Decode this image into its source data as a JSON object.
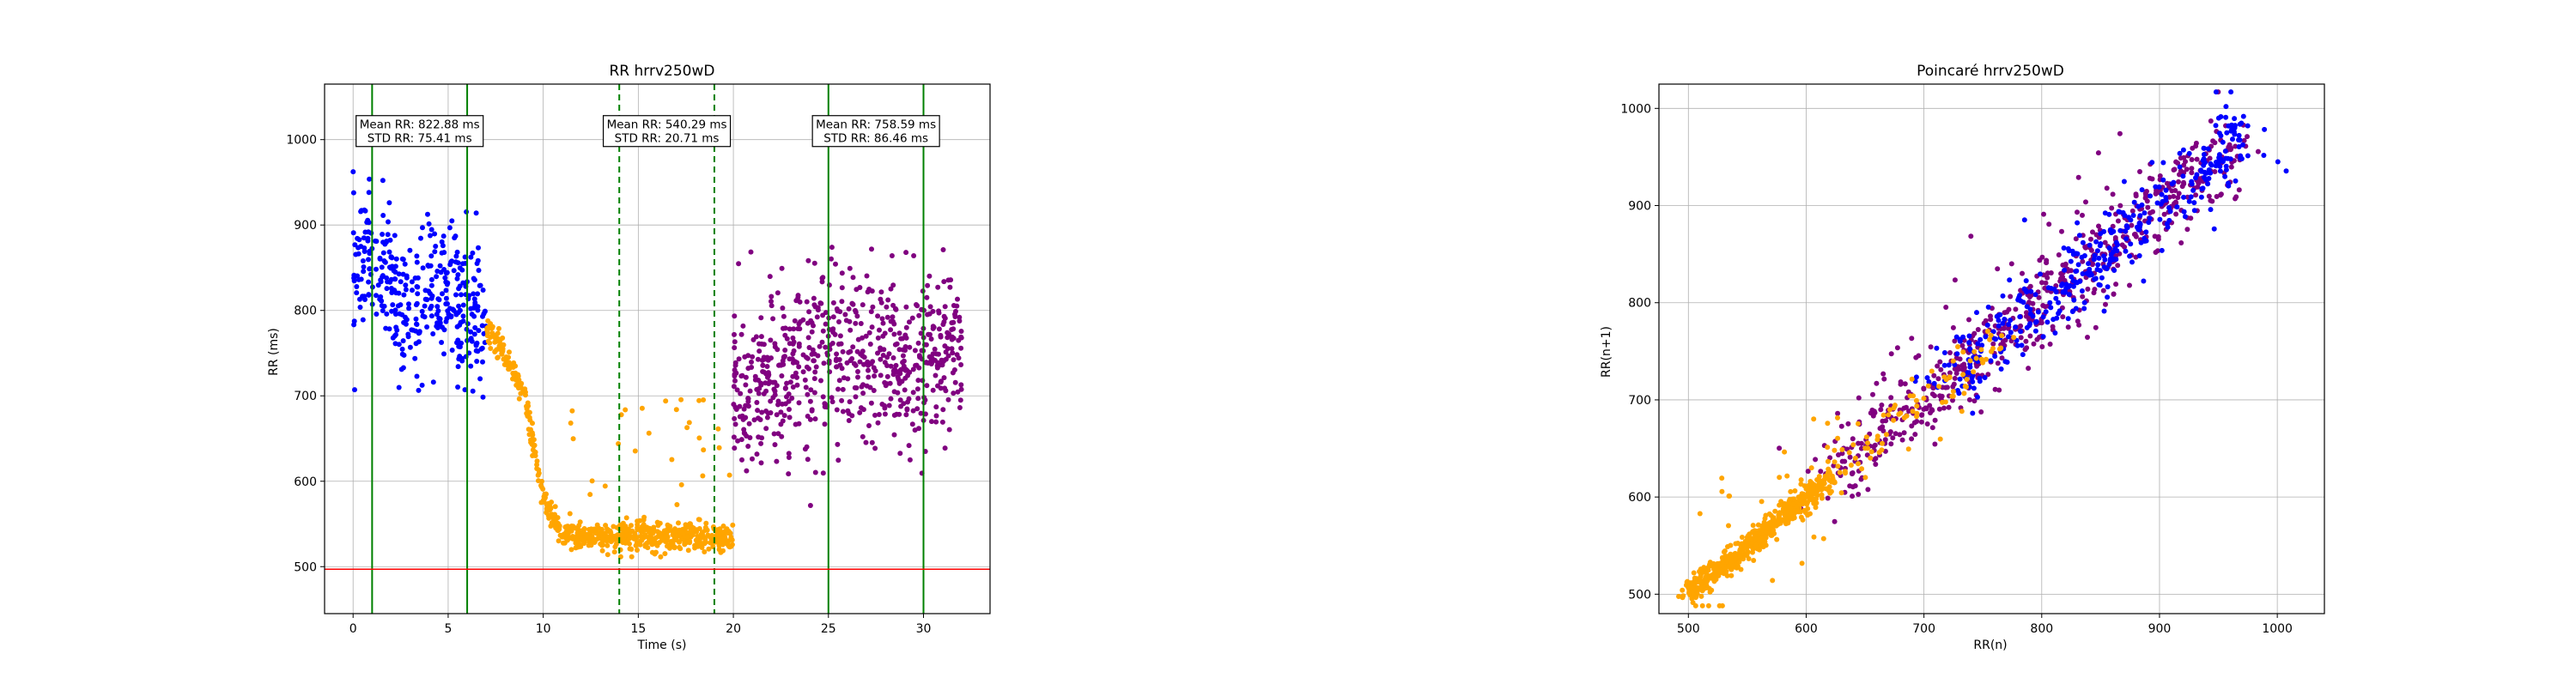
{
  "chart_data": [
    {
      "type": "scatter",
      "title": "RR hrrv250wD",
      "xlabel": "Time (s)",
      "ylabel": "RR (ms)",
      "xlim": [
        -1.5,
        33.5
      ],
      "ylim": [
        445,
        1065
      ],
      "xticks": [
        0,
        5,
        10,
        15,
        20,
        25,
        30
      ],
      "yticks": [
        500,
        600,
        700,
        800,
        900,
        1000
      ],
      "grid": true,
      "colors": {
        "series_a": "#0000ff",
        "series_b": "#ffa500",
        "series_c": "#800080",
        "window": "#008000",
        "threshold": "#ff0000"
      },
      "segments": [
        {
          "color": "series_a",
          "x_range": [
            0,
            7
          ],
          "level_points": [
            [
              0,
              850
            ],
            [
              1,
              860
            ],
            [
              2,
              830
            ],
            [
              3,
              780
            ],
            [
              4,
              840
            ],
            [
              5,
              820
            ],
            [
              6,
              800
            ],
            [
              7,
              790
            ]
          ],
          "spread": 75,
          "count": 380
        },
        {
          "color": "series_b",
          "x_range": [
            7,
            20
          ],
          "level_points": [
            [
              7,
              780
            ],
            [
              8,
              750
            ],
            [
              9,
              700
            ],
            [
              10,
              580
            ],
            [
              11,
              535
            ],
            [
              20,
              535
            ]
          ],
          "spread": 15,
          "count": 700
        },
        {
          "color": "series_c",
          "x_range": [
            20,
            32
          ],
          "level_points": [
            [
              20,
              700
            ],
            [
              22,
              720
            ],
            [
              25,
              760
            ],
            [
              28,
              740
            ],
            [
              32,
              760
            ]
          ],
          "spread": 85,
          "count": 680
        }
      ],
      "vlines": [
        {
          "x": 1,
          "style": "solid"
        },
        {
          "x": 6,
          "style": "solid"
        },
        {
          "x": 14,
          "style": "dashed"
        },
        {
          "x": 19,
          "style": "dashed"
        },
        {
          "x": 25,
          "style": "solid"
        },
        {
          "x": 30,
          "style": "solid"
        }
      ],
      "hline": {
        "y": 497
      },
      "annotations": [
        {
          "x_center": 3.5,
          "y": 1010,
          "lines": [
            "Mean RR: 822.88 ms",
            "STD RR: 75.41 ms"
          ]
        },
        {
          "x_center": 16.5,
          "y": 1010,
          "lines": [
            "Mean RR: 540.29 ms",
            "STD RR: 20.71 ms"
          ]
        },
        {
          "x_center": 27.5,
          "y": 1010,
          "lines": [
            "Mean RR: 758.59 ms",
            "STD RR: 86.46 ms"
          ]
        }
      ]
    },
    {
      "type": "scatter",
      "title": "Poincaré hrrv250wD",
      "xlabel": "RR(n)",
      "ylabel": "RR(n+1)",
      "xlim": [
        475,
        1040
      ],
      "ylim": [
        480,
        1025
      ],
      "xticks": [
        500,
        600,
        700,
        800,
        900,
        1000
      ],
      "yticks": [
        500,
        600,
        700,
        800,
        900,
        1000
      ],
      "grid": true,
      "colors": {
        "series_a": "#0000ff",
        "series_b": "#ffa500",
        "series_c": "#800080"
      },
      "clusters": [
        {
          "color": "series_c",
          "range": [
            620,
            960
          ],
          "spread": 35,
          "count": 650
        },
        {
          "color": "series_a",
          "range": [
            720,
            980
          ],
          "spread": 30,
          "count": 380
        },
        {
          "color": "series_b",
          "range": [
            500,
            620
          ],
          "spread": 10,
          "count": 600
        },
        {
          "color": "series_b",
          "range": [
            620,
            760
          ],
          "spread": 20,
          "count": 90
        }
      ]
    }
  ]
}
